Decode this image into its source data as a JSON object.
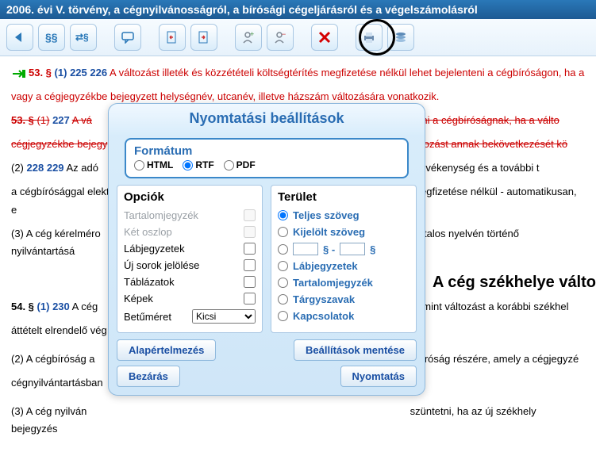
{
  "title": "2006. évi V. törvény, a cégnyilvánosságról, a bírósági cégeljárásról és a végelszámolásról",
  "body": {
    "p53": {
      "ref": "53. §",
      "sub": "(1)",
      "n1": "225",
      "n2": "226",
      "text": "A változást illeték és közzétételi költségtérítés megfizetése nélkül lehet bejelenteni a cégbíróságon, ha a",
      "line2": "vagy a cégjegyzékbe bejegyzett helységnév, utcanév, illetve házszám változására vonatkozik."
    },
    "p53b": {
      "ref": "53. §",
      "sub": "(1)",
      "n1": "227",
      "text_a": "A vá",
      "text_b": "lenteni a cégbíróságnak, ha a válto",
      "line2_a": "cégjegyzékbe bejegy",
      "line2_b": "a változást annak bekövetkezését kö"
    },
    "p2": {
      "sub": "(2)",
      "n1": "228",
      "n2": "229",
      "text_a": "Az adó",
      "text_b": "rvezet, a főtevékenység és a további t",
      "line2_a": "a cégbírósággal elektr",
      "line2_b": "megfizetése nélkül - automatikusan, e"
    },
    "p3": {
      "sub": "(3)",
      "text_a": "A cég kérelméro",
      "text_b": "talos nyelvén történő nyilvántartásá"
    },
    "heading": "A cég székhelye válto",
    "p54": {
      "ref": "54. §",
      "sub": "(1)",
      "n1": "230",
      "text_a": "A cég",
      "text_b": "ését, mint változást a korábbi székhel",
      "line2": "áttételt elrendelő vég"
    },
    "p54_2": {
      "sub": "(2)",
      "text_a": "A cégbíróság a",
      "text_b": "gbíróság részére, amely a cégjegyzé",
      "line2": "cégnyilvántartásban"
    },
    "p54_3": {
      "sub": "(3)",
      "text_a": "A cég nyilván",
      "text_b": "szüntetni, ha az új székhely bejegyzés"
    }
  },
  "dialog": {
    "title": "Nyomtatási beállítások",
    "format": {
      "label": "Formátum",
      "html": "HTML",
      "rtf": "RTF",
      "pdf": "PDF"
    },
    "options": {
      "label": "Opciók",
      "toc": "Tartalomjegyzék",
      "twocol": "Két oszlop",
      "footnotes": "Lábjegyzetek",
      "newlines": "Új sorok jelölése",
      "tables": "Táblázatok",
      "images": "Képek",
      "fontsize": "Betűméret",
      "fontsize_val": "Kicsi"
    },
    "area": {
      "label": "Terület",
      "full": "Teljes szöveg",
      "sel": "Kijelölt szöveg",
      "range_sep": "§ -",
      "range_end": "§",
      "foot": "Lábjegyzetek",
      "toc": "Tartalomjegyzék",
      "keywords": "Tárgyszavak",
      "links": "Kapcsolatok"
    },
    "buttons": {
      "defaults": "Alapértelmezés",
      "save": "Beállítások mentése",
      "close": "Bezárás",
      "print": "Nyomtatás"
    }
  }
}
